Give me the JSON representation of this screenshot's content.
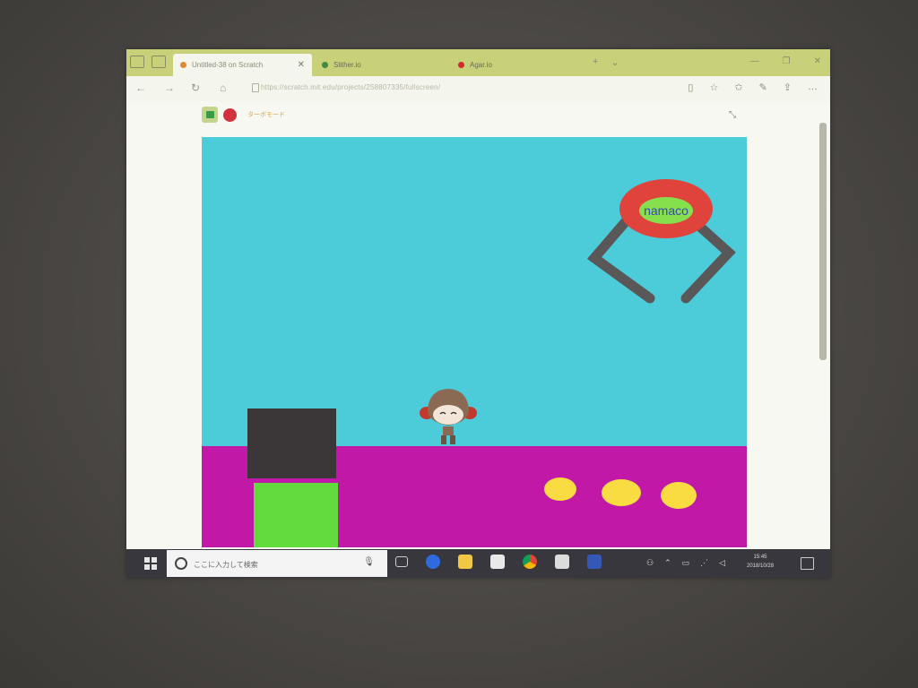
{
  "browser": {
    "tabs": [
      {
        "label": "Untitled-38 on Scratch",
        "icon": "scratch-icon",
        "active": true,
        "dot_color": "#e08a2e"
      },
      {
        "label": "Slither.io",
        "icon": "slither-icon",
        "active": false,
        "dot_color": "#3f8a3f"
      },
      {
        "label": "Agar.io",
        "icon": "agar-icon",
        "active": false,
        "dot_color": "#d02a2a"
      }
    ],
    "url": "https://scratch.mit.edu/projects/258807335/fullscreen/"
  },
  "player": {
    "turbo_label": "ターボモード",
    "green_flag_icon": "green-flag-icon",
    "stop_icon": "stop-icon"
  },
  "stage": {
    "claw_label": "namaco",
    "colors": {
      "sky": "#4ccbd9",
      "ground": "#c118a7",
      "dark_block": "#3b3638",
      "green_block": "#63db3d",
      "coin": "#f8dc42",
      "claw_ring": "#e0423c",
      "claw_inner": "#86e04e",
      "claw_arm": "#5a5758"
    },
    "coins": 3
  },
  "taskbar": {
    "search_placeholder": "ここに入力して検索",
    "time": "15:45",
    "date": "2018/10/28"
  }
}
